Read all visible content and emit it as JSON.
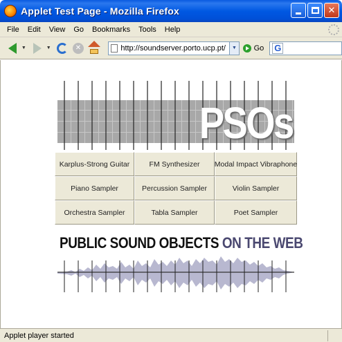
{
  "window": {
    "title": "Applet Test Page - Mozilla Firefox",
    "controls": [
      "minimize",
      "maximize",
      "close"
    ]
  },
  "menu": {
    "items": [
      {
        "label": "File",
        "hotkey": "F"
      },
      {
        "label": "Edit",
        "hotkey": "E"
      },
      {
        "label": "View",
        "hotkey": "V"
      },
      {
        "label": "Go",
        "hotkey": "G"
      },
      {
        "label": "Bookmarks",
        "hotkey": "B"
      },
      {
        "label": "Tools",
        "hotkey": "T"
      },
      {
        "label": "Help",
        "hotkey": "H"
      }
    ]
  },
  "toolbar": {
    "url": "http://soundserver.porto.ucp.pt/",
    "go_label": "Go",
    "search_engine_icon": "G"
  },
  "banner": {
    "logo_text": "PSOs"
  },
  "instruments": [
    [
      "Karplus-Strong Guitar",
      "FM Synthesizer",
      "Modal Impact Vibraphone"
    ],
    [
      "Piano Sampler",
      "Percussion Sampler",
      "Violin Sampler"
    ],
    [
      "Orchestra Sampler",
      "Tabla Sampler",
      "Poet Sampler"
    ]
  ],
  "headline": {
    "part1": "PUBLIC SOUND OBJECTS",
    "part2": "ON THE WEB"
  },
  "status": {
    "text": "Applet player started"
  },
  "colors": {
    "titlebar": "#0058e2",
    "chrome": "#ece9d8",
    "accent_text": "#4a4870",
    "wave": "#b8b8d0"
  }
}
